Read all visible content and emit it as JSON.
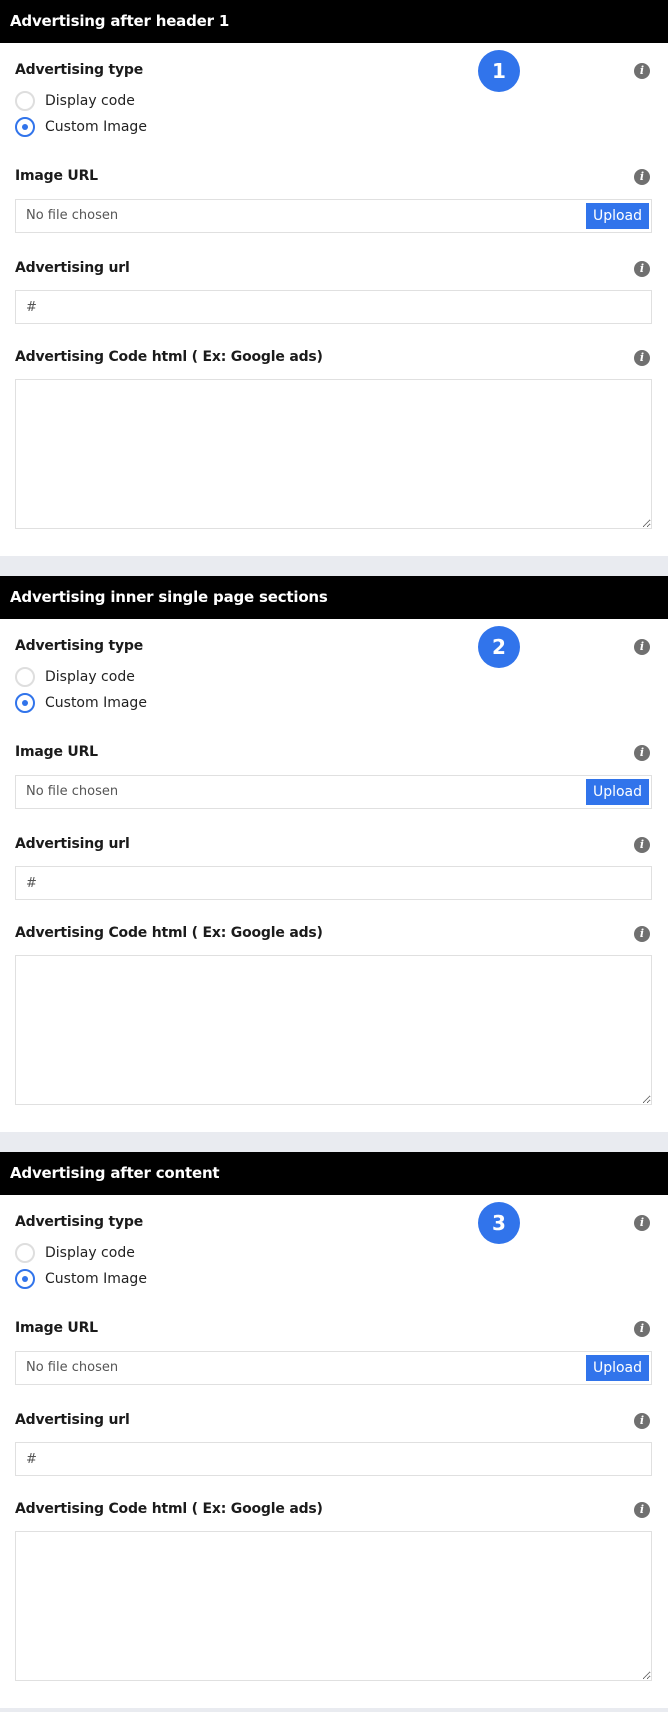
{
  "sections": [
    {
      "title": "Advertising after header 1",
      "badge": "1",
      "type_label": "Advertising type",
      "radio_display": "Display code",
      "radio_custom": "Custom Image",
      "image_url_label": "Image URL",
      "file_status": "No file chosen",
      "upload_label": "Upload",
      "ad_url_label": "Advertising url",
      "ad_url_placeholder": "#",
      "code_label": "Advertising Code html ( Ex: Google ads)"
    },
    {
      "title": "Advertising inner single page sections",
      "badge": "2",
      "type_label": "Advertising type",
      "radio_display": "Display code",
      "radio_custom": "Custom Image",
      "image_url_label": "Image URL",
      "file_status": "No file chosen",
      "upload_label": "Upload",
      "ad_url_label": "Advertising url",
      "ad_url_placeholder": "#",
      "code_label": "Advertising Code html ( Ex: Google ads)"
    },
    {
      "title": "Advertising after content",
      "badge": "3",
      "type_label": "Advertising type",
      "radio_display": "Display code",
      "radio_custom": "Custom Image",
      "image_url_label": "Image URL",
      "file_status": "No file chosen",
      "upload_label": "Upload",
      "ad_url_label": "Advertising url",
      "ad_url_placeholder": "#",
      "code_label": "Advertising Code html ( Ex: Google ads)"
    }
  ],
  "info_icon_glyph": "i",
  "colors": {
    "accent": "#3174eb",
    "header_bg": "#000000",
    "page_bg": "#e9ebf0",
    "info_icon": "#707070"
  }
}
